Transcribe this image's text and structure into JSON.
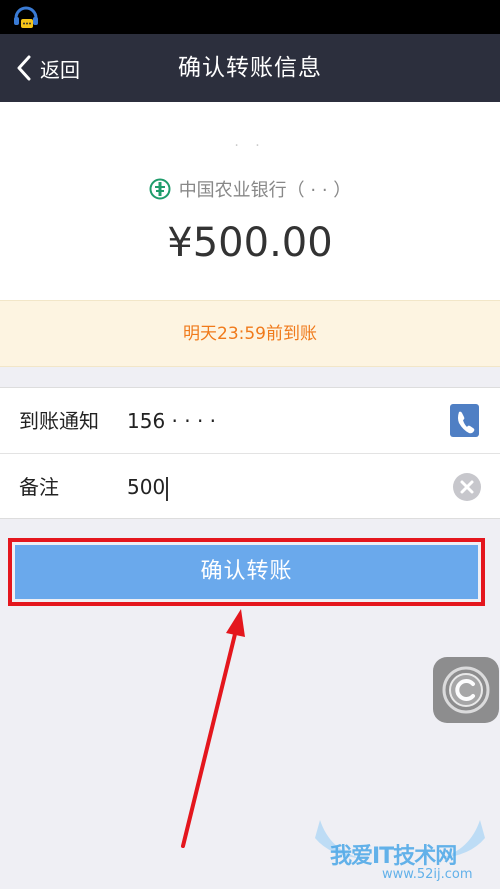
{
  "nav": {
    "back_label": "返回",
    "title": "确认转账信息"
  },
  "recipient": {
    "name": "· ·",
    "bank": "中国农业银行（ · · ）",
    "amount": "¥500.00"
  },
  "notice": "明天23:59前到账",
  "form": {
    "notify_label": "到账通知",
    "notify_value": "156 · · · ·",
    "remark_label": "备注",
    "remark_value": "500"
  },
  "confirm_label": "确认转账",
  "watermark": {
    "text": "我爱IT技术网",
    "url": "www.52ij.com"
  },
  "colors": {
    "nav_bg": "#2c2f3d",
    "notice_text": "#f07a1b",
    "button": "#6aa9ec",
    "highlight": "#e4161d",
    "bank_green": "#1f9c6b"
  }
}
